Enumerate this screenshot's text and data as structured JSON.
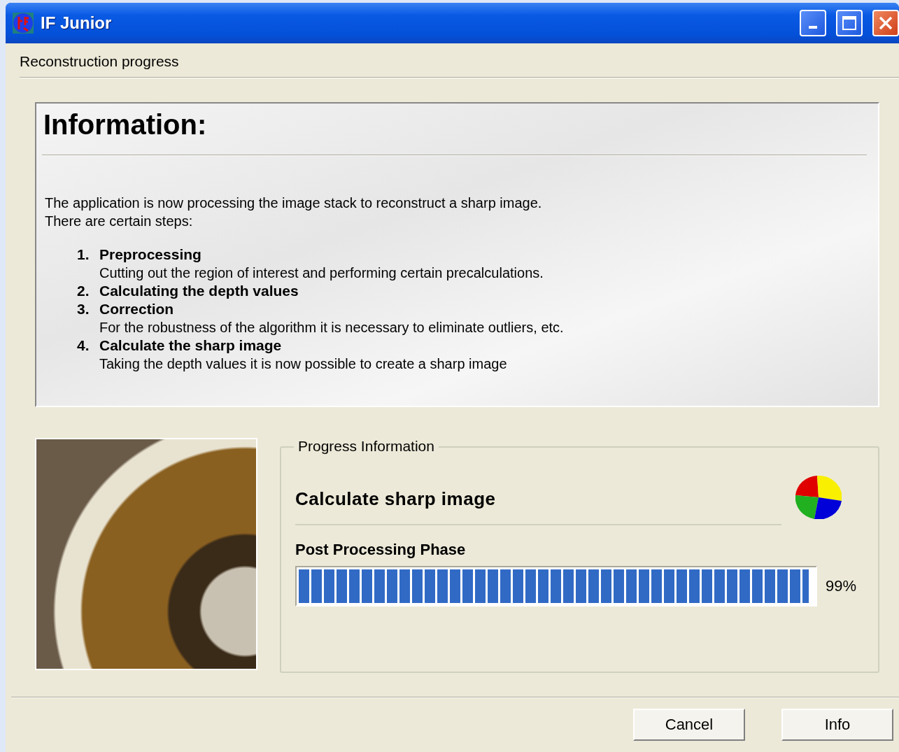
{
  "window": {
    "title": "IF Junior"
  },
  "header": "Reconstruction progress",
  "information": {
    "heading": "Information:",
    "intro": [
      "The application is now processing the image stack to reconstruct a sharp image.",
      "There are certain steps:"
    ],
    "steps": [
      {
        "number": "1.",
        "title": "Preprocessing",
        "description": "Cutting out the region of interest and performing certain precalculations."
      },
      {
        "number": "2.",
        "title": "Calculating the depth values"
      },
      {
        "number": "3.",
        "title": "Correction",
        "description": "For the robustness of the algorithm it is necessary to eliminate outliers, etc."
      },
      {
        "number": "4.",
        "title": "Calculate the sharp image",
        "description": "Taking the depth values it is now possible to create a sharp image"
      }
    ]
  },
  "progress": {
    "group_title": "Progress Information",
    "stage": "Calculate sharp image",
    "phase": "Post Processing Phase",
    "level": 0.99,
    "reading": "99%"
  },
  "buttons": [
    "Cancel",
    "Info"
  ]
}
